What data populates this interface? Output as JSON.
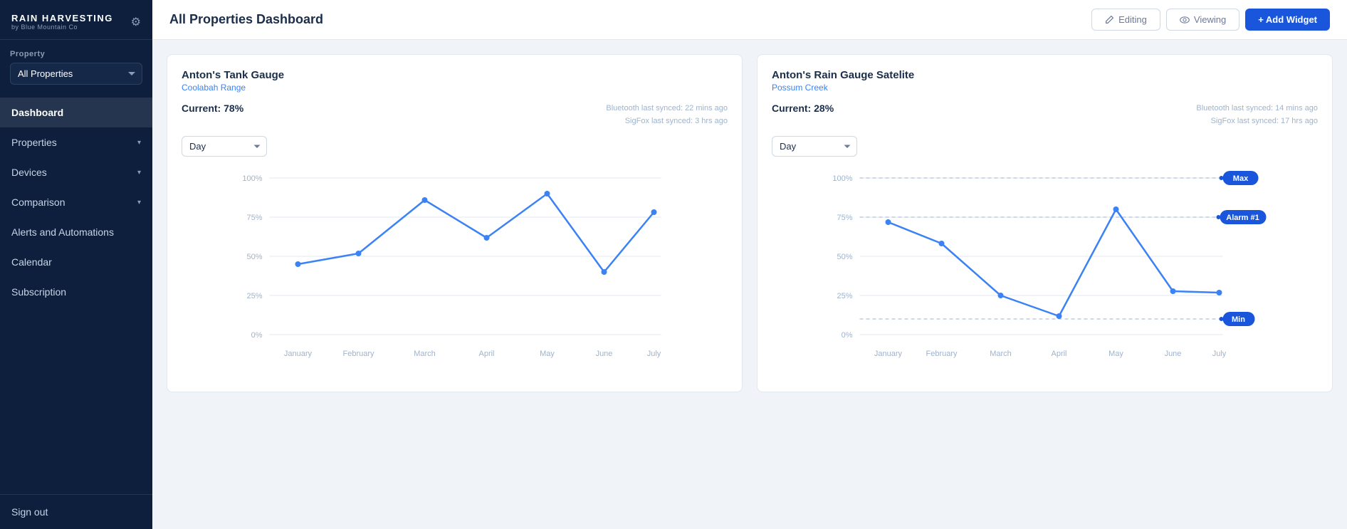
{
  "sidebar": {
    "logo_main": "RAIN HARVESTING",
    "logo_sub": "by Blue Mountain Co",
    "property_label": "Property",
    "property_value": "All Properties",
    "nav_items": [
      {
        "label": "Dashboard",
        "active": true,
        "has_chevron": false
      },
      {
        "label": "Properties",
        "active": false,
        "has_chevron": true
      },
      {
        "label": "Devices",
        "active": false,
        "has_chevron": true
      },
      {
        "label": "Comparison",
        "active": false,
        "has_chevron": true
      },
      {
        "label": "Alerts and Automations",
        "active": false,
        "has_chevron": false
      },
      {
        "label": "Calendar",
        "active": false,
        "has_chevron": false
      },
      {
        "label": "Subscription",
        "active": false,
        "has_chevron": false
      }
    ],
    "sign_out": "Sign out"
  },
  "header": {
    "page_title": "All Properties Dashboard",
    "editing_label": "Editing",
    "viewing_label": "Viewing",
    "add_widget_label": "+ Add Widget"
  },
  "widgets": [
    {
      "id": "widget1",
      "title": "Anton's Tank Gauge",
      "subtitle": "Coolabah Range",
      "current_label": "Current:",
      "current_value": "78%",
      "sync_line1": "Bluetooth last synced: 22 mins ago",
      "sync_line2": "SigFox last synced: 3 hrs ago",
      "day_select_value": "Day",
      "chart_type": "line",
      "has_badges": false,
      "chart_data": {
        "months": [
          "January",
          "February",
          "March",
          "April",
          "May",
          "June",
          "July"
        ],
        "values": [
          45,
          52,
          86,
          62,
          90,
          40,
          78
        ],
        "y_labels": [
          "100%",
          "75%",
          "50%",
          "25%",
          "0%"
        ]
      }
    },
    {
      "id": "widget2",
      "title": "Anton's Rain Gauge Satelite",
      "subtitle": "Possum Creek",
      "current_label": "Current:",
      "current_value": "28%",
      "sync_line1": "Bluetooth last synced: 14 mins ago",
      "sync_line2": "SigFox last synced: 17 hrs ago",
      "day_select_value": "Day",
      "chart_type": "line",
      "has_badges": true,
      "badges": [
        {
          "label": "Max",
          "y_pct": 100,
          "color": "#1a56db"
        },
        {
          "label": "Alarm #1",
          "y_pct": 75,
          "color": "#1a56db"
        },
        {
          "label": "Min",
          "y_pct": 10,
          "color": "#1a56db"
        }
      ],
      "chart_data": {
        "months": [
          "January",
          "February",
          "March",
          "April",
          "May",
          "June",
          "July"
        ],
        "values": [
          72,
          58,
          25,
          12,
          80,
          28,
          27
        ],
        "y_labels": [
          "100%",
          "75%",
          "50%",
          "25%",
          "0%"
        ]
      }
    }
  ]
}
